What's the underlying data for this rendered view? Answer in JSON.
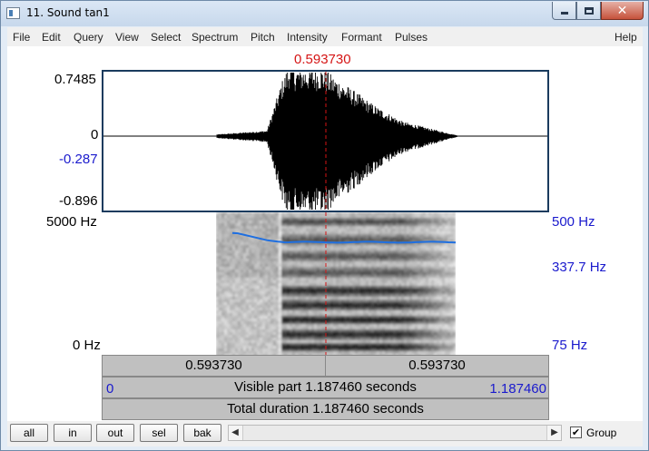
{
  "window": {
    "title": "11. Sound tan1",
    "controls": {
      "minimize": "minimize-icon",
      "maximize": "maximize-icon",
      "close": "close-icon"
    }
  },
  "menu": [
    "File",
    "Edit",
    "Query",
    "View",
    "Select",
    "Spectrum",
    "Pitch",
    "Intensity",
    "Formant",
    "Pulses"
  ],
  "menu_help": "Help",
  "cursor_time": "0.593730",
  "waveform": {
    "max_label": "0.7485",
    "zero_label": "0",
    "cursor_value": "-0.287",
    "min_label": "-0.896"
  },
  "spectrogram": {
    "freq_top": "5000 Hz",
    "freq_bottom": "0 Hz",
    "pitch_top": "500 Hz",
    "pitch_value": "337.7 Hz",
    "pitch_bottom": "75 Hz"
  },
  "time_bars": {
    "left_segment": "0.593730",
    "right_segment": "0.593730",
    "visible_start": "0",
    "visible_part": "Visible part 1.187460 seconds",
    "visible_end": "1.187460",
    "total_duration": "Total duration 1.187460 seconds"
  },
  "toolbar": {
    "buttons": [
      "all",
      "in",
      "out",
      "sel",
      "bak"
    ],
    "group_label": "Group",
    "group_checked": true,
    "check_mark": "✔"
  },
  "colors": {
    "cursor": "#d51515",
    "pitch_line": "#1f6fe0",
    "axis_blue": "#1a1acd",
    "frame": "#1a3b5e"
  }
}
